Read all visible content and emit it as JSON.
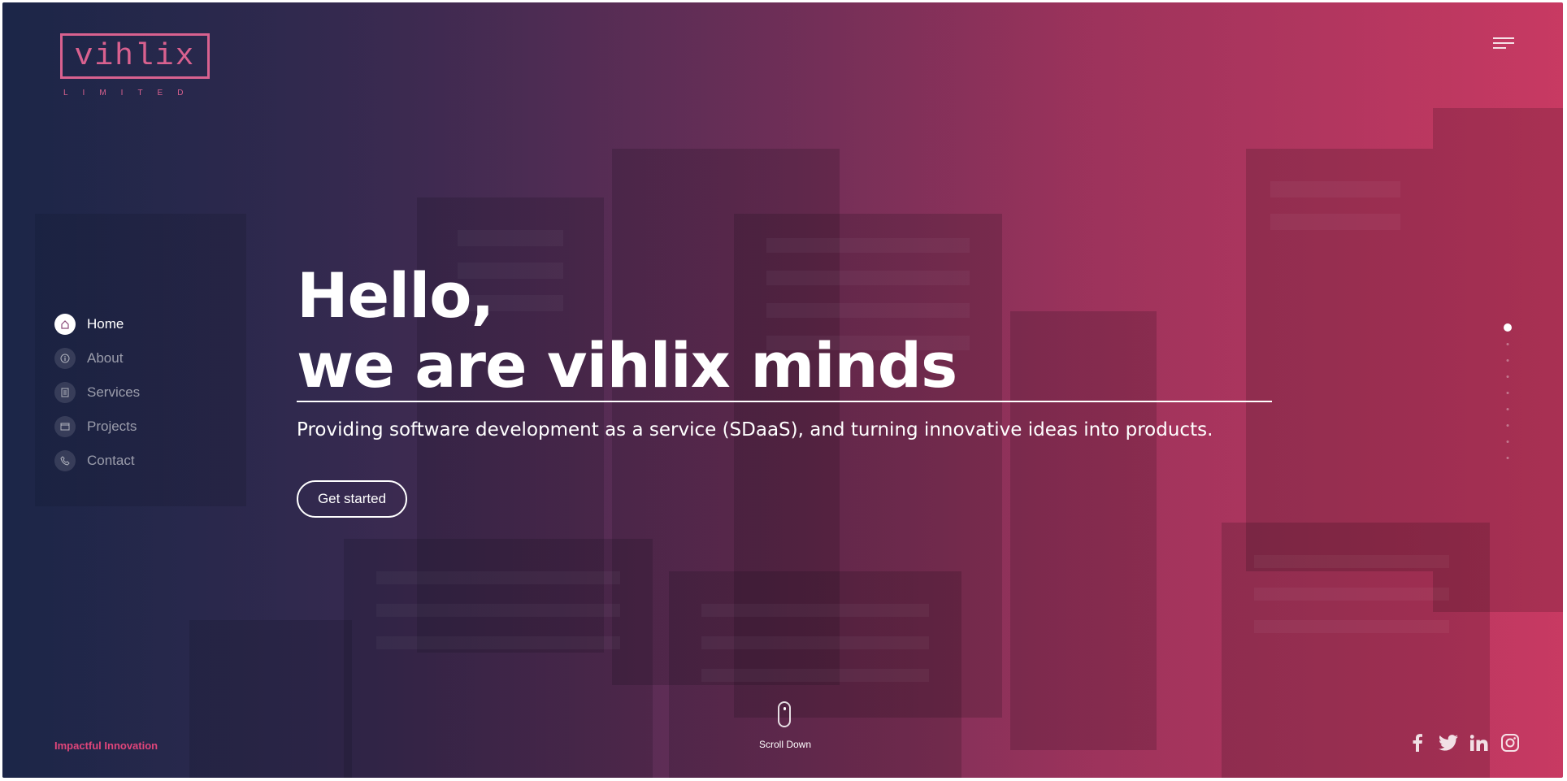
{
  "logo": {
    "wordmark": "vihlix",
    "subline": "LIMITED"
  },
  "nav": {
    "items": [
      {
        "label": "Home",
        "icon": "home-icon",
        "active": true
      },
      {
        "label": "About",
        "icon": "info-icon",
        "active": false
      },
      {
        "label": "Services",
        "icon": "services-icon",
        "active": false
      },
      {
        "label": "Projects",
        "icon": "projects-icon",
        "active": false
      },
      {
        "label": "Contact",
        "icon": "phone-icon",
        "active": false
      }
    ]
  },
  "hero": {
    "line1": "Hello,",
    "line2": "we are vihlix minds",
    "subtitle": "Providing software development as a service (SDaaS), and turning innovative ideas into products.",
    "cta_label": "Get started"
  },
  "scroll": {
    "label": "Scroll Down"
  },
  "footer": {
    "tagline": "Impactful Innovation"
  },
  "social": [
    "facebook-icon",
    "twitter-icon",
    "linkedin-icon",
    "instagram-icon"
  ],
  "pagination": {
    "total": 9,
    "active_index": 0
  },
  "colors": {
    "accent": "#d9618f",
    "tagline": "#e0457a",
    "gradient_start": "#1f2a4a",
    "gradient_end": "#c83a63"
  }
}
